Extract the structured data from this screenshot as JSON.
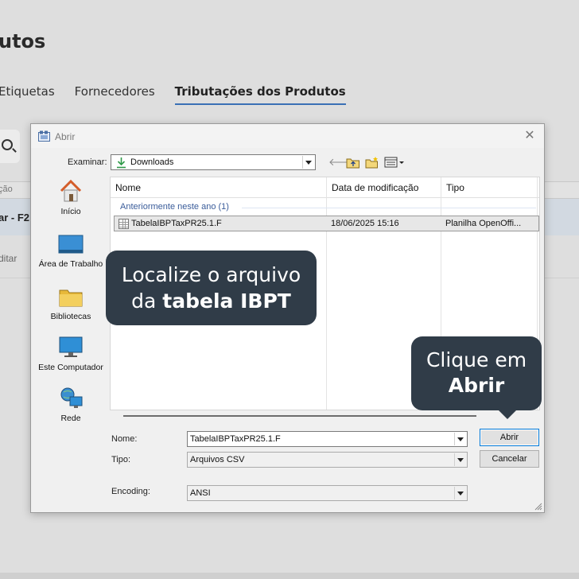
{
  "background": {
    "title": "utos",
    "tabs": [
      {
        "label": "Etiquetas"
      },
      {
        "label": "Fornecedores"
      },
      {
        "label": "Tributações dos Produtos"
      }
    ],
    "column_header": "ção",
    "row_selected": "ar - F2",
    "row_action": "ditar"
  },
  "dialog": {
    "title": "Abrir",
    "look_in_label": "Examinar:",
    "look_in_value": "Downloads",
    "places": [
      {
        "label": "Início",
        "icon": "home-icon"
      },
      {
        "label": "Área de Trabalho",
        "icon": "desktop-icon"
      },
      {
        "label": "Bibliotecas",
        "icon": "libraries-icon"
      },
      {
        "label": "Este Computador",
        "icon": "computer-icon"
      },
      {
        "label": "Rede",
        "icon": "network-icon"
      }
    ],
    "columns": {
      "name": "Nome",
      "modified": "Data de modificação",
      "type": "Tipo"
    },
    "group_label": "Anteriormente neste ano (1)",
    "files": [
      {
        "name": "TabelaIBPTaxPR25.1.F",
        "modified": "18/06/2025 15:16",
        "type": "Planilha OpenOffi..."
      }
    ],
    "name_label": "Nome:",
    "name_value": "TabelaIBPTaxPR25.1.F",
    "type_label": "Tipo:",
    "type_value": "Arquivos CSV",
    "encoding_label": "Encoding:",
    "encoding_value": "ANSI",
    "open_button": "Abrir",
    "cancel_button": "Cancelar"
  },
  "callouts": {
    "locate_line1": "Localize o arquivo",
    "locate_prefix": "da ",
    "locate_bold": "tabela IBPT",
    "click_line1": "Clique em",
    "click_bold": "Abrir"
  },
  "colors": {
    "callout_bg": "#303c48",
    "active_tab_underline": "#3a70b5",
    "group_text": "#3a5c9a"
  }
}
